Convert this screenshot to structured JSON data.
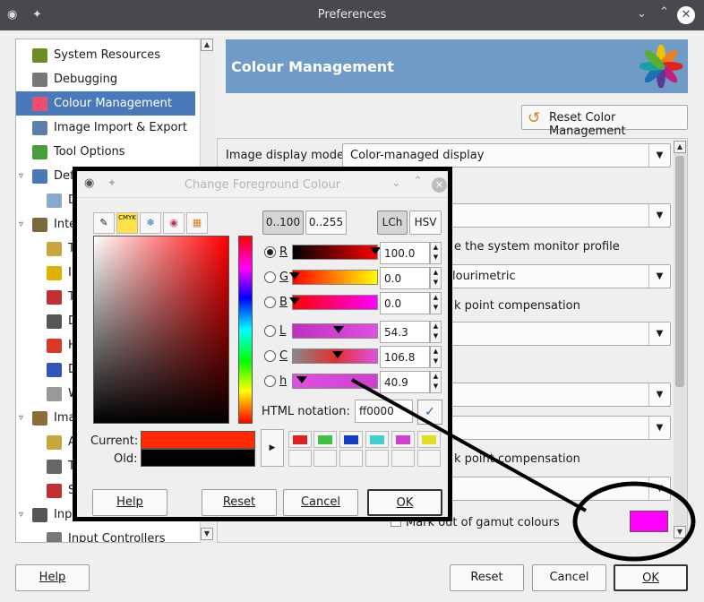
{
  "window": {
    "title": "Preferences"
  },
  "tree": {
    "items": [
      {
        "label": "System Resources",
        "icon": "system-resources-icon",
        "color": "#6b8e23"
      },
      {
        "label": "Debugging",
        "icon": "debug-icon",
        "color": "#777777"
      },
      {
        "label": "Colour Management",
        "icon": "colour-wheel-icon",
        "color": "#e94e77",
        "selected": true
      },
      {
        "label": "Image Import & Export",
        "icon": "image-import-icon",
        "color": "#5d7fa8"
      },
      {
        "label": "Tool Options",
        "icon": "tool-options-icon",
        "color": "#4a9e3a"
      },
      {
        "label": "Def",
        "icon": "default-image-icon",
        "color": "#4a79b9",
        "expander": true
      },
      {
        "label": "D",
        "icon": "default-grid-icon",
        "color": "#88aacc",
        "indent": true
      },
      {
        "label": "Inte",
        "icon": "interface-icon",
        "color": "#7a6a3a",
        "expander": true
      },
      {
        "label": "T",
        "icon": "theme-icon",
        "color": "#c9a63a",
        "indent": true
      },
      {
        "label": "I",
        "icon": "icon-theme-icon",
        "color": "#e0b000",
        "indent": true
      },
      {
        "label": "T",
        "icon": "toolbox-icon",
        "color": "#c03030",
        "indent": true
      },
      {
        "label": "D",
        "icon": "dialog-defaults-icon",
        "color": "#555555",
        "indent": true
      },
      {
        "label": "H",
        "icon": "help-system-icon",
        "color": "#d83a2a",
        "indent": true
      },
      {
        "label": "D",
        "icon": "display-icon",
        "color": "#3355bb",
        "indent": true
      },
      {
        "label": "W",
        "icon": "window-management-icon",
        "color": "#999999",
        "indent": true
      },
      {
        "label": "Ima",
        "icon": "image-windows-icon",
        "color": "#8c6d3a",
        "expander": true
      },
      {
        "label": "A",
        "icon": "appearance-icon",
        "color": "#c9a63a",
        "indent": true
      },
      {
        "label": "T",
        "icon": "title-status-icon",
        "color": "#666666",
        "indent": true
      },
      {
        "label": "S",
        "icon": "snapping-icon",
        "color": "#c03030",
        "indent": true
      },
      {
        "label": "Inp",
        "icon": "input-devices-icon",
        "color": "#555555",
        "expander": true
      },
      {
        "label": "Input Controllers",
        "icon": "input-controllers-icon",
        "color": "#777777",
        "indent": true
      }
    ]
  },
  "panel": {
    "title": "Colour Management",
    "reset_label": "Reset Color Management",
    "display_mode_label": "Image display mode:",
    "display_mode_value": "Color-managed display",
    "monitor_profile_label": "e the system monitor profile",
    "intent_value": "lourimetric",
    "bpc_label_1": "k point compensation",
    "bpc_label_2": "k point compensation",
    "gamut_label": "Mark out of gamut colours",
    "gamut_color": "#ff00ff"
  },
  "dialog": {
    "title": "Change Foreground Colour",
    "tabs": [
      "gimp-selector-icon",
      "cmyk-icon",
      "watercolor-icon",
      "wheel-icon",
      "palette-icon"
    ],
    "cmyk_text": "CMYK",
    "range_buttons": [
      "0..100",
      "0..255"
    ],
    "model_buttons": [
      "LCh",
      "HSV"
    ],
    "channels": [
      {
        "key": "R",
        "value": "100.0",
        "selected": true,
        "marker": 0.98,
        "gradient": "linear-gradient(to right,#000,#ff0000)"
      },
      {
        "key": "G",
        "value": "0.0",
        "selected": false,
        "marker": 0.02,
        "gradient": "linear-gradient(to right,#ff0000,#ffff00)"
      },
      {
        "key": "B",
        "value": "0.0",
        "selected": false,
        "marker": 0.02,
        "gradient": "linear-gradient(to right,#ff0000,#ff00ff)"
      },
      {
        "key": "L",
        "value": "54.3",
        "selected": false,
        "marker": 0.54,
        "gradient": "linear-gradient(to right,#c030c0,#e050e0)"
      },
      {
        "key": "C",
        "value": "106.8",
        "selected": false,
        "marker": 0.53,
        "gradient": "linear-gradient(to right,#888,#e03030 50%,#e050e0)"
      },
      {
        "key": "h",
        "value": "40.9",
        "selected": false,
        "marker": 0.11,
        "gradient": "linear-gradient(to right,#e050e0,#d040d0)"
      }
    ],
    "html_label": "HTML notation:",
    "html_value": "ff0000",
    "current_label": "Current:",
    "old_label": "Old:",
    "current_color": "#ff2a00",
    "old_color": "#000000",
    "history_colors": [
      "#e02020",
      "#40c040",
      "#1040c0",
      "#40d0d0",
      "#d040d0",
      "#e0e020"
    ],
    "help": "Help",
    "reset": "Reset",
    "cancel": "Cancel",
    "ok": "OK"
  },
  "footer": {
    "help": "Help",
    "reset": "Reset",
    "cancel": "Cancel",
    "ok": "OK"
  }
}
